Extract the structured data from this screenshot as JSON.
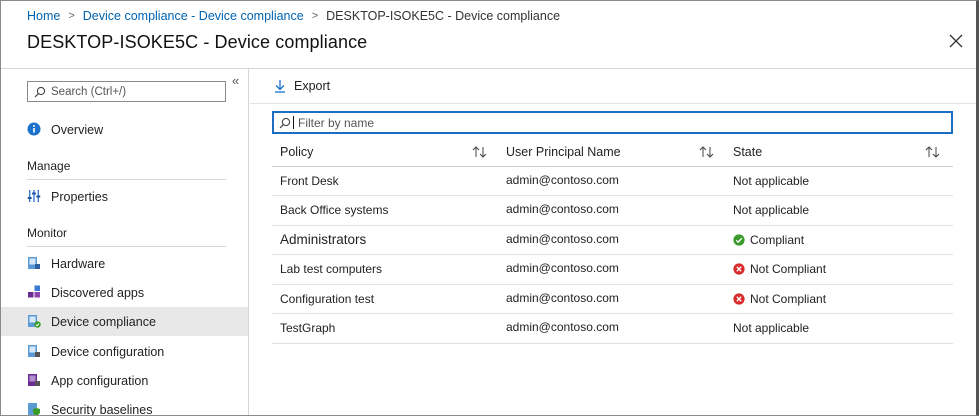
{
  "breadcrumb": {
    "home": "Home",
    "parent": "Device compliance - Device compliance",
    "current": "DESKTOP-ISOKE5C - Device compliance"
  },
  "page_title": "DESKTOP-ISOKE5C - Device compliance",
  "sidebar": {
    "search_placeholder": "Search (Ctrl+/)",
    "overview": "Overview",
    "section_manage": "Manage",
    "properties": "Properties",
    "section_monitor": "Monitor",
    "monitor_items": [
      {
        "label": "Hardware",
        "icon": "hardware-icon"
      },
      {
        "label": "Discovered apps",
        "icon": "discovered-apps-icon"
      },
      {
        "label": "Device compliance",
        "icon": "device-compliance-icon",
        "selected": true
      },
      {
        "label": "Device configuration",
        "icon": "device-configuration-icon"
      },
      {
        "label": "App configuration",
        "icon": "app-configuration-icon"
      },
      {
        "label": "Security baselines",
        "icon": "security-baselines-icon"
      }
    ]
  },
  "toolbar": {
    "export_label": "Export"
  },
  "filter": {
    "placeholder": "Filter by name"
  },
  "table": {
    "headers": [
      "Policy",
      "User Principal Name",
      "State"
    ],
    "rows": [
      {
        "policy": "Front Desk",
        "upn": "admin@contoso.com",
        "state": "Not applicable",
        "status": "none"
      },
      {
        "policy": "Back Office systems",
        "upn": "admin@contoso.com",
        "state": "Not applicable",
        "status": "none"
      },
      {
        "policy": "Administrators",
        "upn": "admin@contoso.com",
        "state": "Compliant",
        "status": "ok"
      },
      {
        "policy": "Lab test computers",
        "upn": "admin@contoso.com",
        "state": "Not Compliant",
        "status": "error"
      },
      {
        "policy": "Configuration test",
        "upn": "admin@contoso.com",
        "state": "Not Compliant",
        "status": "error"
      },
      {
        "policy": "TestGraph",
        "upn": "admin@contoso.com",
        "state": "Not applicable",
        "status": "none"
      }
    ]
  },
  "colors": {
    "link": "#0063b1",
    "compliant": "#3a9b2a",
    "not_compliant": "#d92b2b",
    "focus_border": "#1b6ec2",
    "selected_bg": "#e8e8e8"
  }
}
